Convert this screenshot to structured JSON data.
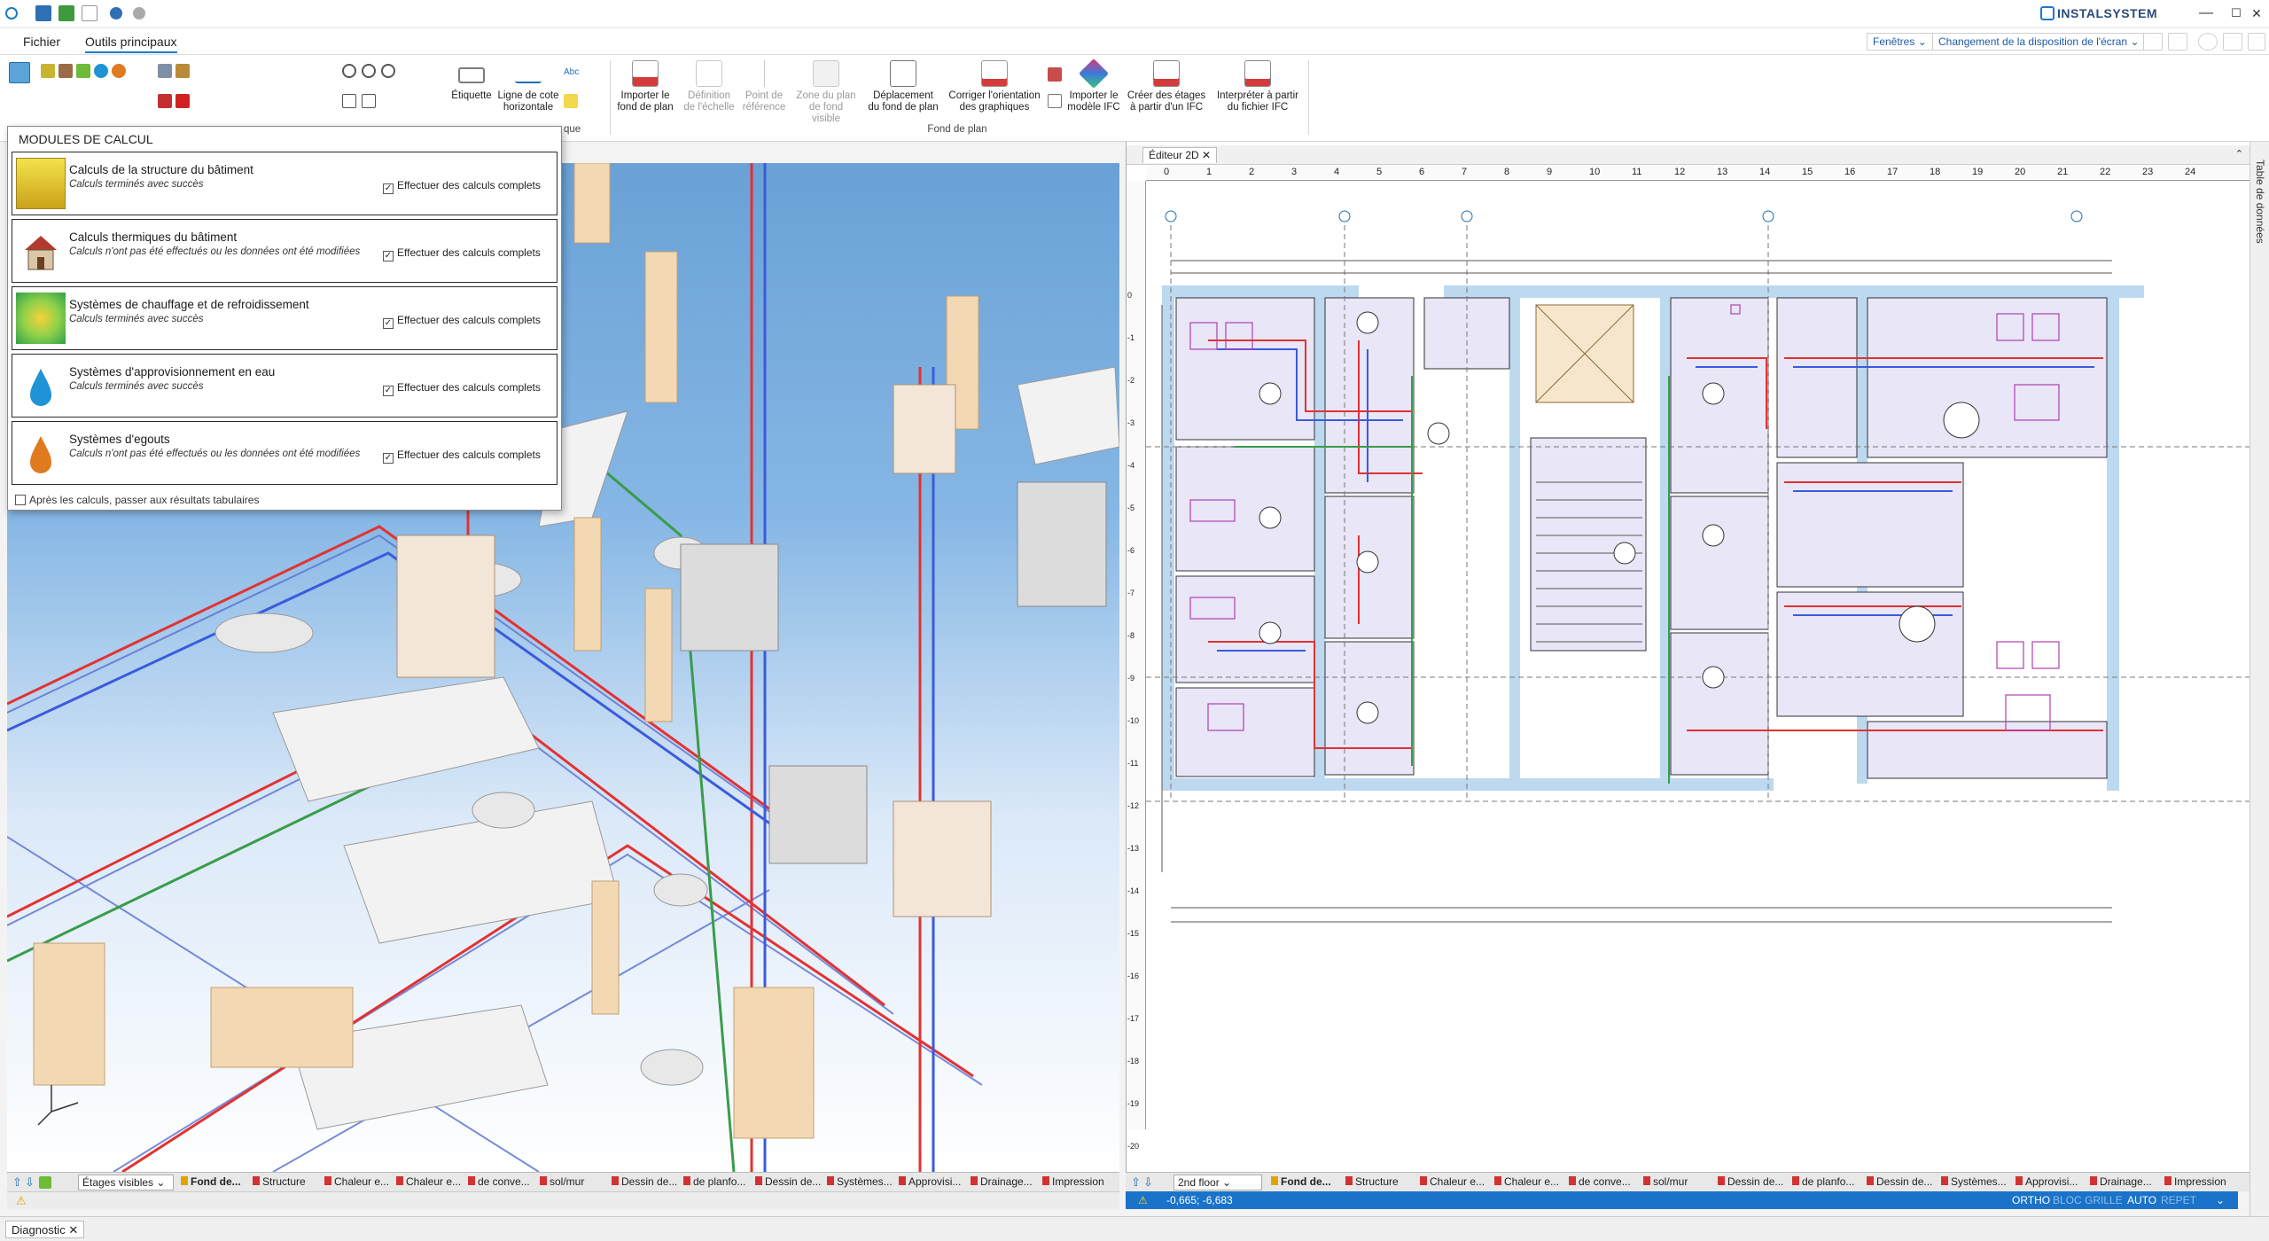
{
  "window": {
    "brand": "INSTALSYSTEM",
    "minimize": "—",
    "maximize": "☐",
    "close": "✕"
  },
  "menu": {
    "tabs": [
      "Fichier",
      "Outils principaux"
    ],
    "windows_label": "Fenêtres",
    "layout_label": "Changement de la disposition de l'écran"
  },
  "ribbon": {
    "buttons": {
      "etiquette": "Étiquette",
      "ligne_cote_1": "Ligne de cote",
      "ligne_cote_2": "horizontale",
      "importer_fond_1": "Importer le",
      "importer_fond_2": "fond de plan",
      "definition_1": "Définition",
      "definition_2": "de l'échelle",
      "point_ref_1": "Point de",
      "point_ref_2": "référence",
      "zone_1": "Zone du plan",
      "zone_2": "de fond visible",
      "deplacement_1": "Déplacement",
      "deplacement_2": "du fond de plan",
      "corriger_1": "Corriger l'orientation",
      "corriger_2": "des graphiques",
      "importer_ifc_1": "Importer le",
      "importer_ifc_2": "modèle IFC",
      "creer_1": "Créer des étages",
      "creer_2": "à partir d'un IFC",
      "interpreter_1": "Interpréter à partir",
      "interpreter_2": "du fichier IFC"
    },
    "group_fond": "Fond de plan",
    "group_partial": "que"
  },
  "modules": {
    "title": "MODULES DE CALCUL",
    "check_label": "Effectuer des calculs complets",
    "rows": [
      {
        "name": "Calculs de la structure du bâtiment",
        "state": "Calculs terminés avec succès"
      },
      {
        "name": "Calculs thermiques du bâtiment",
        "state": "Calculs n'ont pas été effectués ou les données ont été modifiées"
      },
      {
        "name": "Systèmes de chauffage et de refroidissement",
        "state": "Calculs terminés avec succès"
      },
      {
        "name": "Systèmes d'approvisionnement en eau",
        "state": "Calculs terminés avec succès"
      },
      {
        "name": "Systèmes d'egouts",
        "state": "Calculs n'ont pas été effectués ou les données ont été modifiées"
      }
    ],
    "footer": "Après les calculs, passer aux résultats tabulaires"
  },
  "editor": {
    "tab": "Éditeur 2D",
    "side_label": "Table de données"
  },
  "ruler": {
    "h": [
      "0",
      "1",
      "2",
      "3",
      "4",
      "5",
      "6",
      "7",
      "8",
      "9",
      "10",
      "11",
      "12",
      "13",
      "14",
      "15",
      "16",
      "17",
      "18",
      "19",
      "20",
      "21",
      "22",
      "23",
      "24"
    ],
    "v": [
      "0",
      "-1",
      "-2",
      "-3",
      "-4",
      "-5",
      "-6",
      "-7",
      "-8",
      "-9",
      "-10",
      "-11",
      "-12",
      "-13",
      "-14",
      "-15",
      "-16",
      "-17",
      "-18",
      "-19",
      "-20"
    ]
  },
  "left_status": {
    "select": "Étages visibles",
    "tabs": [
      "Fond de...",
      "Structure",
      "Chaleur e...",
      "Chaleur e...",
      "de conve...",
      "sol/mur",
      "Dessin de...",
      "de planfo...",
      "Dessin de...",
      "Systèmes...",
      "Approvisi...",
      "Drainage...",
      "Impression"
    ]
  },
  "right_status": {
    "select": "2nd floor",
    "tabs": [
      "Fond de...",
      "Structure",
      "Chaleur e...",
      "Chaleur e...",
      "de conve...",
      "sol/mur",
      "Dessin de...",
      "de planfo...",
      "Dessin de...",
      "Systèmes...",
      "Approvisi...",
      "Drainage...",
      "Impression"
    ]
  },
  "coords": {
    "value": "-0,665; -6,683",
    "ortho": "ORTHO",
    "bloc": "BLOC",
    "grille": "GRILLE",
    "auto": "AUTO",
    "repet": "REPET"
  },
  "diagnostic": {
    "tab": "Diagnostic"
  },
  "colors": {
    "accent": "#1a73c9",
    "hot_pipe": "#e23232",
    "cold_pipe": "#3b5bdc",
    "green_pipe": "#3a9c4a",
    "room_fill": "#e8e6f7",
    "wall": "#bcd9f0"
  }
}
